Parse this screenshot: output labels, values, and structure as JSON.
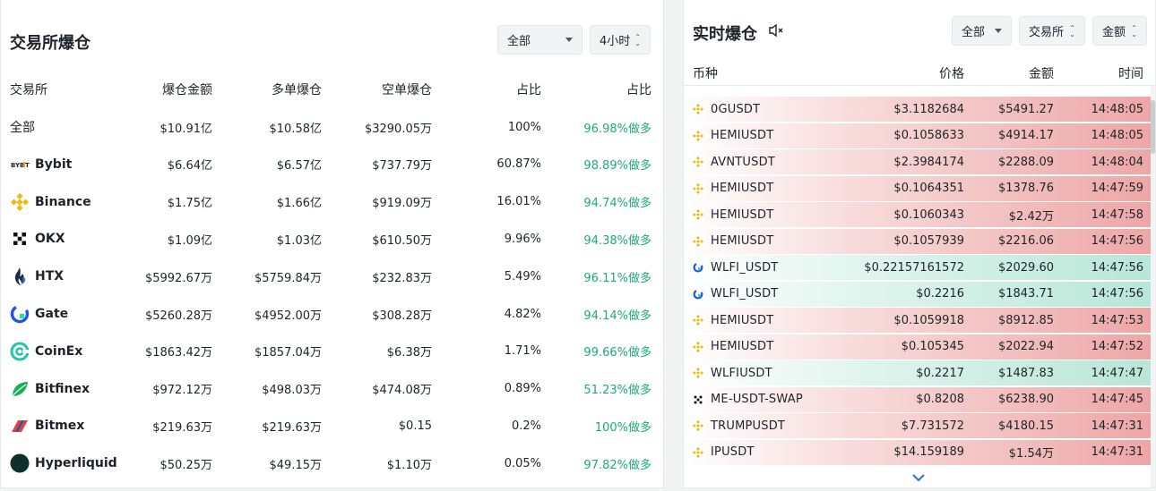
{
  "left": {
    "title": "交易所爆仓",
    "filter_scope": "全部",
    "filter_time": "4小时",
    "headers": [
      "交易所",
      "爆仓金额",
      "多单爆仓",
      "空单爆仓",
      "占比",
      "占比"
    ],
    "rows": [
      {
        "name": "全部",
        "total": "$10.91亿",
        "long": "$10.58亿",
        "short": "$3290.05万",
        "share": "100%",
        "ratio": "96.98%做多",
        "icon": "none"
      },
      {
        "name": "Bybit",
        "total": "$6.64亿",
        "long": "$6.57亿",
        "short": "$737.79万",
        "share": "60.87%",
        "ratio": "98.89%做多",
        "icon": "bybit-icon"
      },
      {
        "name": "Binance",
        "total": "$1.75亿",
        "long": "$1.66亿",
        "short": "$919.09万",
        "share": "16.01%",
        "ratio": "94.74%做多",
        "icon": "binance-icon"
      },
      {
        "name": "OKX",
        "total": "$1.09亿",
        "long": "$1.03亿",
        "short": "$610.50万",
        "share": "9.96%",
        "ratio": "94.38%做多",
        "icon": "okx-icon"
      },
      {
        "name": "HTX",
        "total": "$5992.67万",
        "long": "$5759.84万",
        "short": "$232.83万",
        "share": "5.49%",
        "ratio": "96.11%做多",
        "icon": "htx-icon"
      },
      {
        "name": "Gate",
        "total": "$5260.28万",
        "long": "$4952.00万",
        "short": "$308.28万",
        "share": "4.82%",
        "ratio": "94.14%做多",
        "icon": "gate-icon"
      },
      {
        "name": "CoinEx",
        "total": "$1863.42万",
        "long": "$1857.04万",
        "short": "$6.38万",
        "share": "1.71%",
        "ratio": "99.66%做多",
        "icon": "coinex-icon"
      },
      {
        "name": "Bitfinex",
        "total": "$972.12万",
        "long": "$498.03万",
        "short": "$474.08万",
        "share": "0.89%",
        "ratio": "51.23%做多",
        "icon": "bitfinex-icon"
      },
      {
        "name": "Bitmex",
        "total": "$219.63万",
        "long": "$219.63万",
        "short": "$0.15",
        "share": "0.2%",
        "ratio": "100%做多",
        "icon": "bitmex-icon"
      },
      {
        "name": "Hyperliquid",
        "total": "$50.25万",
        "long": "$49.15万",
        "short": "$1.10万",
        "share": "0.05%",
        "ratio": "97.82%做多",
        "icon": "hyperliquid-icon"
      }
    ]
  },
  "right": {
    "title": "实时爆仓",
    "filter_scope": "全部",
    "filter_exchange": "交易所",
    "filter_amount": "金额",
    "headers": [
      "币种",
      "价格",
      "金额",
      "时间"
    ],
    "colors": {
      "long_liq": "#eda5a5",
      "short_liq": "#b7e6d6"
    },
    "rows": [
      {
        "symbol": "0GUSDT",
        "price": "$3.1182684",
        "amount": "$5491.27",
        "time": "14:48:05",
        "side": "red",
        "icon": "binance-icon"
      },
      {
        "symbol": "HEMIUSDT",
        "price": "$0.1058633",
        "amount": "$4914.17",
        "time": "14:48:05",
        "side": "red",
        "icon": "binance-icon"
      },
      {
        "symbol": "AVNTUSDT",
        "price": "$2.3984174",
        "amount": "$2288.09",
        "time": "14:48:04",
        "side": "red",
        "icon": "binance-icon"
      },
      {
        "symbol": "HEMIUSDT",
        "price": "$0.1064351",
        "amount": "$1378.76",
        "time": "14:47:59",
        "side": "red",
        "icon": "binance-icon"
      },
      {
        "symbol": "HEMIUSDT",
        "price": "$0.1060343",
        "amount": "$2.42万",
        "time": "14:47:58",
        "side": "red",
        "icon": "binance-icon"
      },
      {
        "symbol": "HEMIUSDT",
        "price": "$0.1057939",
        "amount": "$2216.06",
        "time": "14:47:56",
        "side": "red",
        "icon": "binance-icon"
      },
      {
        "symbol": "WLFI_USDT",
        "price": "$0.22157161572",
        "amount": "$2029.60",
        "time": "14:47:56",
        "side": "grn",
        "icon": "gate-icon"
      },
      {
        "symbol": "WLFI_USDT",
        "price": "$0.2216",
        "amount": "$1843.71",
        "time": "14:47:56",
        "side": "grn",
        "icon": "gate-icon"
      },
      {
        "symbol": "HEMIUSDT",
        "price": "$0.1059918",
        "amount": "$8912.85",
        "time": "14:47:53",
        "side": "red",
        "icon": "binance-icon"
      },
      {
        "symbol": "HEMIUSDT",
        "price": "$0.105345",
        "amount": "$2022.94",
        "time": "14:47:52",
        "side": "red",
        "icon": "binance-icon"
      },
      {
        "symbol": "WLFIUSDT",
        "price": "$0.2217",
        "amount": "$1487.83",
        "time": "14:47:47",
        "side": "grn",
        "icon": "binance-icon"
      },
      {
        "symbol": "ME-USDT-SWAP",
        "price": "$0.8208",
        "amount": "$6238.90",
        "time": "14:47:45",
        "side": "red",
        "icon": "okx-icon"
      },
      {
        "symbol": "TRUMPUSDT",
        "price": "$7.731572",
        "amount": "$4180.15",
        "time": "14:47:31",
        "side": "red",
        "icon": "binance-icon"
      },
      {
        "symbol": "IPUSDT",
        "price": "$14.159189",
        "amount": "$1.54万",
        "time": "14:47:31",
        "side": "red",
        "icon": "binance-icon"
      }
    ]
  }
}
